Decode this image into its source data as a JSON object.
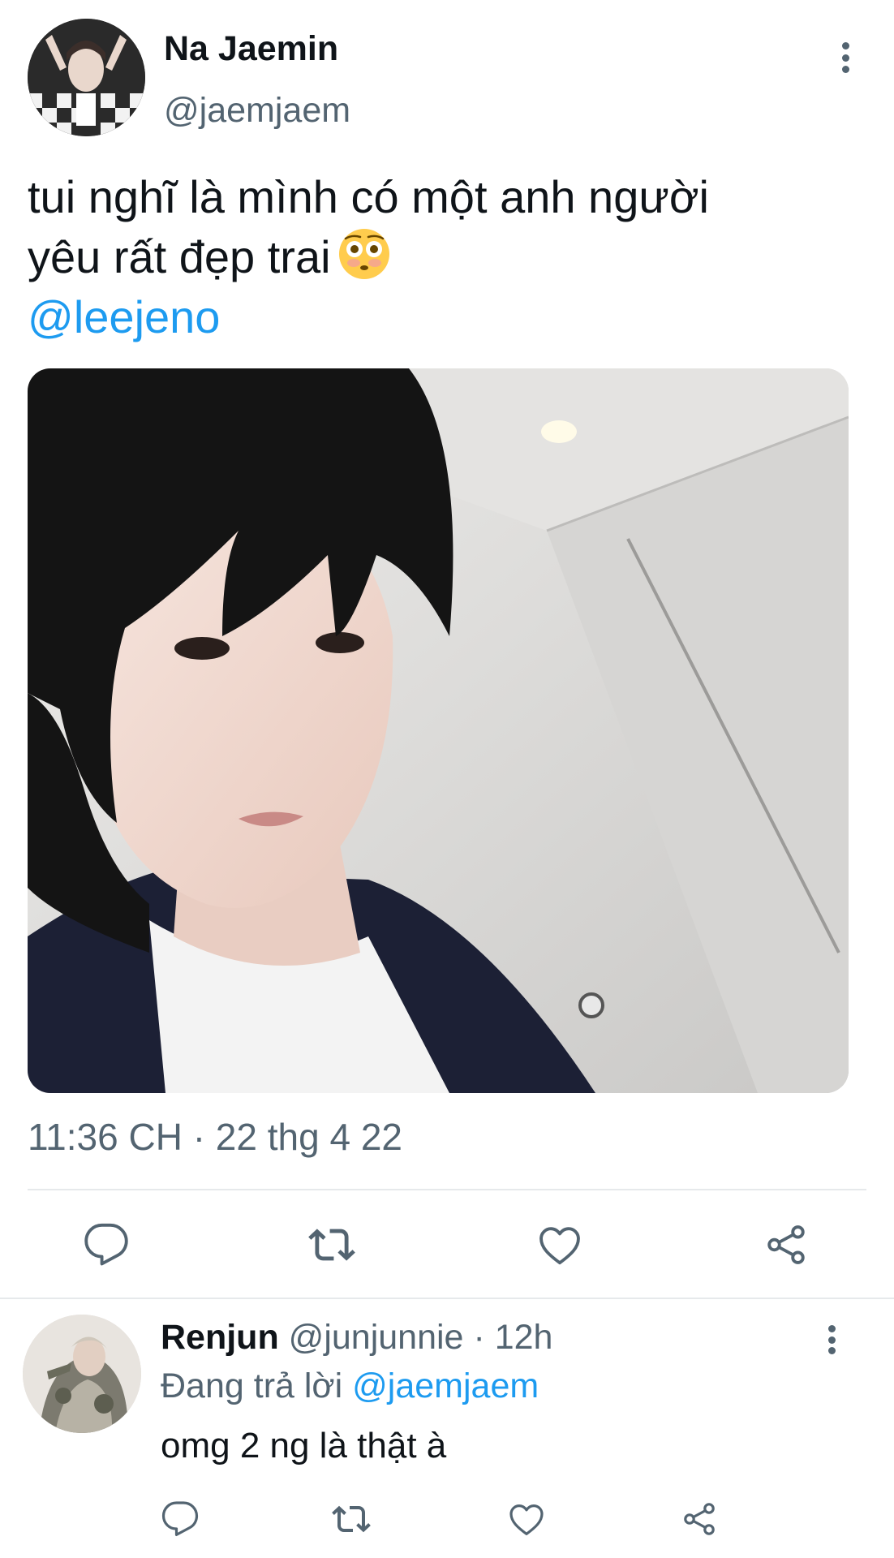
{
  "colors": {
    "accent": "#1d9bf0",
    "text_primary": "#0f1419",
    "text_secondary": "#536471",
    "divider": "#e6e9eb"
  },
  "tweet": {
    "author_name": "Na Jaemin",
    "author_handle": "@jaemjaem",
    "text_line1": "tui nghĩ là mình có một anh người",
    "text_line2": "yêu rất đẹp trai",
    "emoji": "flushed-face-emoji",
    "mention": "@leejeno",
    "timestamp": "11:36 CH · 22 thg 4 22",
    "actions": {
      "reply_icon": "reply-icon",
      "retweet_icon": "retweet-icon",
      "like_icon": "heart-icon",
      "share_icon": "share-icon"
    }
  },
  "reply": {
    "author_name": "Renjun",
    "author_handle": "@junjunnie",
    "time": "· 12h",
    "replying_label": "Đang trả lời",
    "replying_to": "@jaemjaem",
    "text": "omg 2 ng là thật à"
  }
}
